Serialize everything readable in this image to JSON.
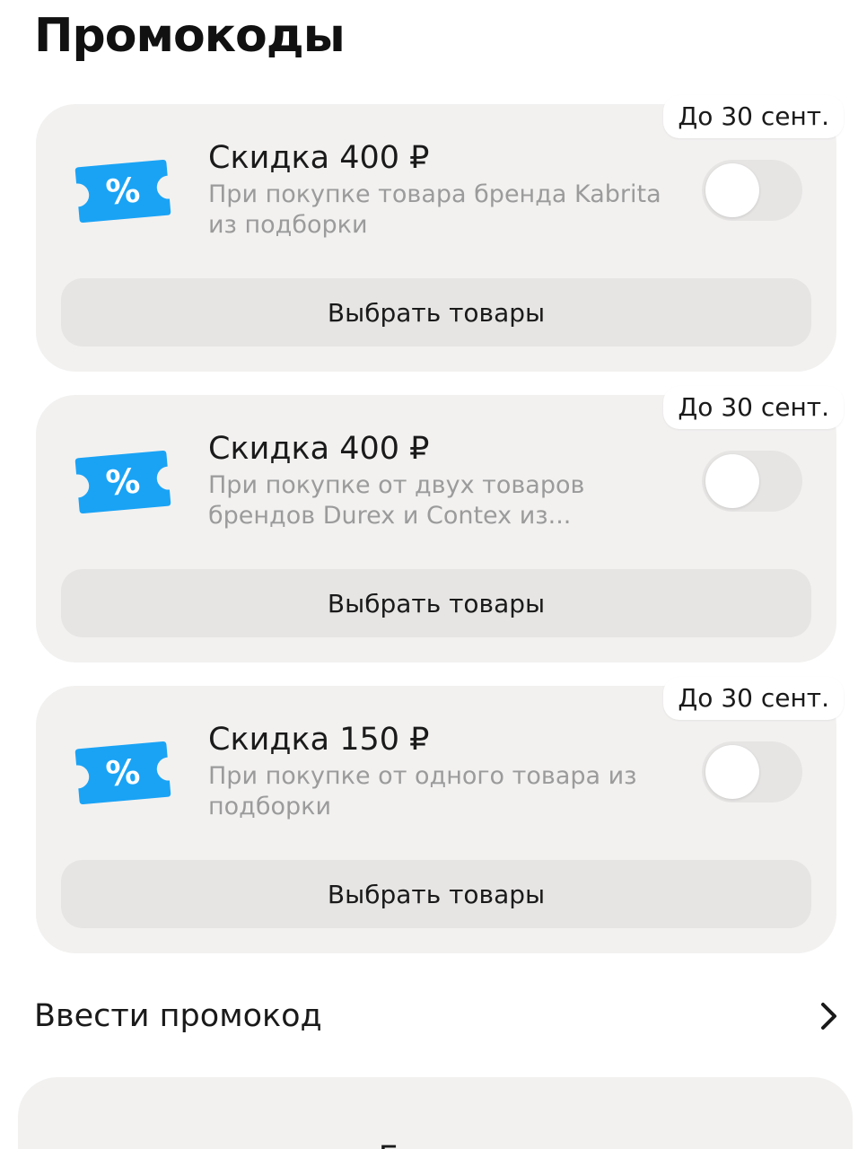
{
  "header": {
    "title": "Промокоды"
  },
  "promos": [
    {
      "deadline": "До 30 сент.",
      "title": "Скидка 400 ₽",
      "description": "При покупке товара бренда Kabrita из подборки",
      "enabled": false,
      "button_label": "Выбрать товары"
    },
    {
      "deadline": "До 30 сент.",
      "title": "Скидка 400 ₽",
      "description": "При покупке от двух товаров брендов Durex и Contex из...",
      "enabled": false,
      "button_label": "Выбрать товары"
    },
    {
      "deadline": "До 30 сент.",
      "title": "Скидка 150 ₽",
      "description": "При покупке от одного товара из подборки",
      "enabled": false,
      "button_label": "Выбрать товары"
    }
  ],
  "enter_promo": {
    "label": "Ввести промокод",
    "icon": "chevron-right-icon"
  },
  "footer": {
    "done_label": "Готово"
  },
  "colors": {
    "accent": "#1aa3f5",
    "card_bg": "#f2f1f0",
    "button_bg": "#e6e5e4",
    "secondary_text": "#9b9b9b"
  }
}
